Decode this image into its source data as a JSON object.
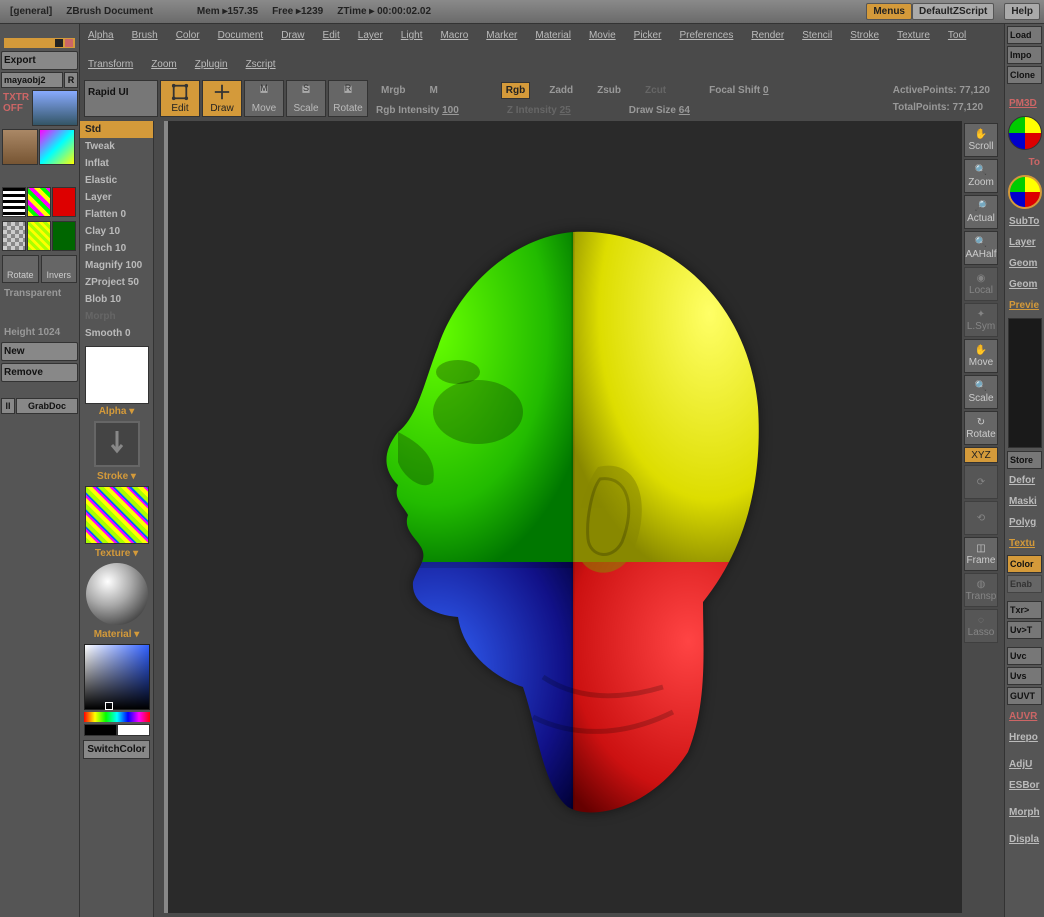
{
  "topbar": {
    "general": "[general]",
    "doc": "ZBrush Document",
    "mem": "Mem ▸157.35",
    "free": "Free ▸1239",
    "ztime": "ZTime ▸ 00:00:02.02",
    "menus": "Menus",
    "defaultzscript": "DefaultZScript",
    "help": "Help"
  },
  "menu": [
    "Alpha",
    "Brush",
    "Color",
    "Document",
    "Draw",
    "Edit",
    "Layer",
    "Light",
    "Macro",
    "Marker",
    "Material",
    "Movie",
    "Picker",
    "Preferences",
    "Render",
    "Stencil",
    "Stroke",
    "Texture",
    "Tool",
    "Transform",
    "Zoom",
    "Zplugin",
    "Zscript"
  ],
  "leftpanel": {
    "export": "Export",
    "mayaobj": "mayaobj2",
    "r": "R",
    "txtr": "TXTR",
    "off": "OFF",
    "rotate": "Rotate",
    "invers": "Invers",
    "transparent": "Transparent",
    "height": "Height 1024",
    "new": "New",
    "remove": "Remove",
    "ll": "ll",
    "grabdoc": "GrabDoc"
  },
  "header": {
    "rapid": "Rapid UI",
    "modes": [
      "Edit",
      "Draw",
      "Move",
      "Scale",
      "Rotate"
    ],
    "mrgb": "Mrgb",
    "m": "M",
    "rgb": "Rgb",
    "zadd": "Zadd",
    "zsub": "Zsub",
    "zcut": "Zcut",
    "rgbint": "Rgb Intensity",
    "rgbint_v": "100",
    "zint": "Z Intensity",
    "zint_v": "25",
    "focal": "Focal Shift",
    "focal_v": "0",
    "draw": "Draw Size",
    "draw_v": "64",
    "active": "ActivePoints:",
    "active_v": "77,120",
    "total": "TotalPoints:",
    "total_v": "77,120"
  },
  "brushes": [
    "Std",
    "Tweak",
    "Inflat",
    "Elastic",
    "Layer",
    "Flatten 0",
    "Clay 10",
    "Pinch 10",
    "Magnify 100",
    "ZProject 50",
    "Blob 10",
    "Morph",
    "Smooth 0"
  ],
  "thumbs": {
    "alpha": "Alpha ▾",
    "stroke": "Stroke ▾",
    "texture": "Texture ▾",
    "material": "Material ▾",
    "switch": "SwitchColor"
  },
  "rtools": [
    "Scroll",
    "Zoom",
    "Actual",
    "AAHalf",
    "Local",
    "L.Sym",
    "Move",
    "Scale",
    "Rotate",
    "XYZ",
    "",
    "",
    "Frame",
    "Transp",
    "Lasso"
  ],
  "farright": {
    "load": "Load",
    "impo": "Impo",
    "clone": "Clone",
    "pm3d": "PM3D",
    "to": "To",
    "subto": "SubTo",
    "layer": "Layer",
    "geom1": "Geom",
    "geom2": "Geom",
    "previe": "Previe",
    "store": "Store",
    "defor": "Defor",
    "mask": "Maski",
    "polyg": "Polyg",
    "textu": "Textu",
    "color": "Color",
    "enab": "Enab",
    "txr": "Txr>",
    "uvt": "Uv>T",
    "uvc": "Uvc",
    "uvs": "Uvs",
    "guvt": "GUVT",
    "auvr": "AUVR",
    "hrepo": "Hrepo",
    "adju": "AdjU",
    "esbor": "ESBor",
    "morph": "Morph",
    "displa": "Displa"
  }
}
